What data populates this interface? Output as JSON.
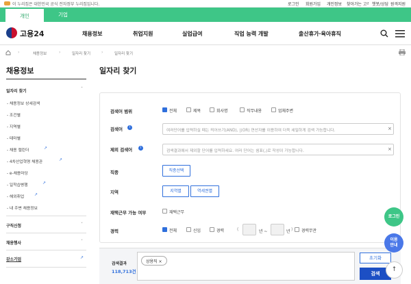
{
  "topbar": {
    "gov_notice": "이 누리집은 대한민국 공식 전자정부 누리집입니다.",
    "links": [
      "로그인",
      "회원가입",
      "개인정보",
      "찾아가는 고객센터",
      "챗봇/상담",
      "원격지원"
    ]
  },
  "user_tabs": [
    "개인",
    "기업"
  ],
  "header": {
    "logo_text": "고용24",
    "nav": [
      "채용정보",
      "취업지원",
      "실업급여",
      "직업 능력 개발",
      "출산휴가·육아휴직"
    ]
  },
  "breadcrumb": [
    "채용정보",
    "일자리 찾기",
    "일자리 찾기"
  ],
  "sidebar": {
    "title": "채용정보",
    "section1": "일자리 찾기",
    "items": [
      "- 채용정보 상세검색",
      "- 조건별",
      "- 지역별",
      "- 테마별",
      "- 채용 캘린더",
      "- 4차산업혁명 채용관",
      "- e-채용마당",
      "- 일학습병행",
      "- 해외취업",
      "- 내 주변 채용정보"
    ],
    "sections": [
      "구직신청",
      "채용행사",
      "강소기업"
    ]
  },
  "main": {
    "title": "일자리 찾기",
    "search_scope": {
      "label": "검색어 범위",
      "options": [
        {
          "label": "전체",
          "checked": true
        },
        {
          "label": "제목",
          "checked": false
        },
        {
          "label": "회사명",
          "checked": false
        },
        {
          "label": "직무내용",
          "checked": false
        },
        {
          "label": "업체주변",
          "checked": false
        }
      ]
    },
    "keyword": {
      "label": "검색어",
      "placeholder": "여러단어를 입력하실 때는 띄어쓰기(AND), |(OR) 연산자를 이용하여 더욱 세밀하게 검색 가능합니다."
    },
    "exclude": {
      "label": "제외 검색어",
      "placeholder": "검색결과에서 제외할 단어를 입력하세요. 여러 단어는 쉼표(,)로 작성이 가능합니다."
    },
    "job": {
      "label": "직종",
      "button": "직종선택"
    },
    "region": {
      "label": "지역",
      "buttons": [
        "지역별",
        "역세권별"
      ]
    },
    "remote": {
      "label": "재택근무 가능 여부",
      "option": "재택근무"
    },
    "career": {
      "label": "경력",
      "options": [
        {
          "label": "전체",
          "checked": true
        },
        {
          "label": "신입",
          "checked": false
        },
        {
          "label": "경력",
          "checked": false
        }
      ],
      "min_sep": "년 ~",
      "max_unit": "년",
      "noexp_option": "경력무관"
    }
  },
  "result": {
    "label": "검색결과",
    "count": "118,713건",
    "chip": "상용직 ×",
    "reset": "초기화",
    "search": "검색"
  },
  "floating": {
    "login": "로그인",
    "guide": "이용\n안내",
    "top_arrow": "↑"
  },
  "colors": {
    "brand_green": "#3ec687",
    "primary_blue": "#2f6fdc"
  }
}
